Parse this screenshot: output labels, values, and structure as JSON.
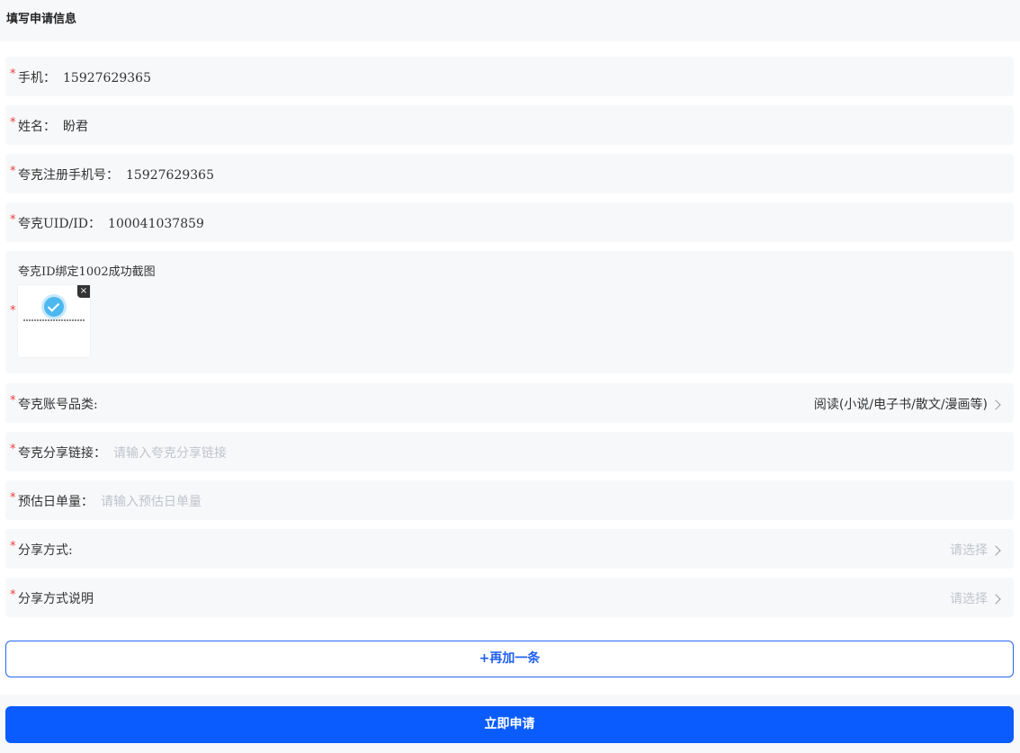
{
  "header": {
    "title": "填写申请信息"
  },
  "form": {
    "phone": {
      "required_mark": "*",
      "label": "手机：",
      "value": "15927629365"
    },
    "name": {
      "required_mark": "*",
      "label": "姓名：",
      "value": "盼君"
    },
    "quark_phone": {
      "required_mark": "*",
      "label": "夸克注册手机号：",
      "value": "15927629365"
    },
    "quark_uid": {
      "required_mark": "*",
      "label": "夸克UID/ID：",
      "value": "100041037859"
    },
    "screenshot": {
      "required_mark": "*",
      "label": "夸克ID绑定1002成功截图",
      "remove_glyph": "×"
    },
    "category": {
      "required_mark": "*",
      "label": "夸克账号品类:",
      "value": "阅读(小说/电子书/散文/漫画等)"
    },
    "share_link": {
      "required_mark": "*",
      "label": "夸克分享链接：",
      "placeholder": "请输入夸克分享链接"
    },
    "daily_orders": {
      "required_mark": "*",
      "label": "预估日单量：",
      "placeholder": "请输入预估日单量"
    },
    "share_method": {
      "required_mark": "*",
      "label": "分享方式:",
      "placeholder": "请选择"
    },
    "share_method_desc": {
      "required_mark": "*",
      "label": "分享方式说明",
      "placeholder": "请选择"
    }
  },
  "actions": {
    "add_more": "+再加一条",
    "submit": "立即申请"
  },
  "colors": {
    "primary": "#0b5cff",
    "required": "#ee3b3b",
    "row_bg": "#f7f8fa",
    "placeholder": "#c0c4cc"
  }
}
